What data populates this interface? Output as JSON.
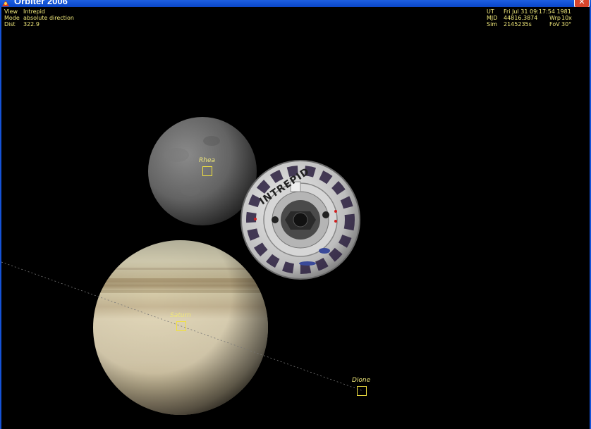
{
  "window": {
    "title": "Orbiter 2006",
    "close_glyph": "✕"
  },
  "hud_left": {
    "rows": [
      {
        "key": "View",
        "value": "Intrepid"
      },
      {
        "key": "Mode",
        "value": "absolute direction"
      },
      {
        "key": "Dist",
        "value": "322.9"
      }
    ]
  },
  "hud_right": {
    "rows": [
      {
        "key": "UT",
        "value": "Fri Jul 31 09:17:54 1981",
        "key2": "",
        "value2": ""
      },
      {
        "key": "MJD",
        "value": "44816.3874",
        "key2": "Wrp",
        "value2": "10x"
      },
      {
        "key": "Sim",
        "value": "2145235s",
        "key2": "FoV",
        "value2": "30°"
      }
    ]
  },
  "markers": {
    "rhea": {
      "label": "Rhea"
    },
    "saturn": {
      "label": "Saturn"
    },
    "dione": {
      "label": "Dione"
    }
  },
  "vessel": {
    "name_text": "INTREPID"
  },
  "colors": {
    "hud_text": "#f0e87a",
    "marker": "#f0e040",
    "titlebar": "#0a46c8",
    "space": "#000000"
  },
  "icons": {
    "app": "orbiter-app-icon",
    "close": "close-icon"
  }
}
